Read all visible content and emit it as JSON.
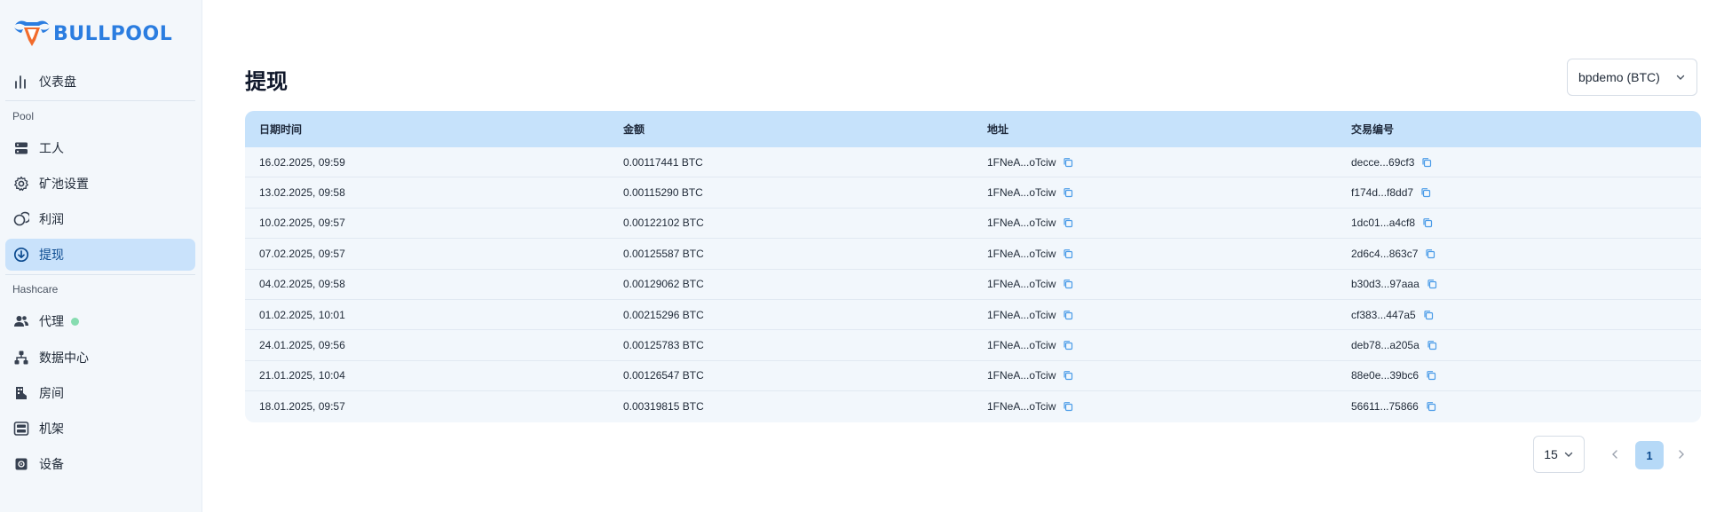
{
  "brand": {
    "name": "BULLPOOL"
  },
  "sidebar": {
    "top_items": [
      {
        "label": "仪表盘",
        "icon": "bar-chart-icon"
      }
    ],
    "sections": [
      {
        "label": "Pool",
        "items": [
          {
            "label": "工人",
            "icon": "server-icon"
          },
          {
            "label": "矿池设置",
            "icon": "gear-icon"
          },
          {
            "label": "利润",
            "icon": "coins-icon"
          },
          {
            "label": "提现",
            "icon": "download-circle-icon",
            "active": true
          }
        ]
      },
      {
        "label": "Hashcare",
        "items": [
          {
            "label": "代理",
            "icon": "users-icon",
            "status_dot": "online"
          },
          {
            "label": "数据中心",
            "icon": "hierarchy-icon"
          },
          {
            "label": "房间",
            "icon": "room-icon"
          },
          {
            "label": "机架",
            "icon": "rack-icon"
          },
          {
            "label": "设备",
            "icon": "device-icon"
          }
        ]
      }
    ]
  },
  "main": {
    "title": "提现",
    "account_select": {
      "value": "bpdemo (BTC)"
    },
    "table": {
      "columns": [
        "日期时间",
        "金额",
        "地址",
        "交易编号"
      ],
      "rows": [
        {
          "datetime": "16.02.2025, 09:59",
          "amount": "0.00117441 BTC",
          "address": "1FNeA...oTciw",
          "txid": "decce...69cf3"
        },
        {
          "datetime": "13.02.2025, 09:58",
          "amount": "0.00115290 BTC",
          "address": "1FNeA...oTciw",
          "txid": "f174d...f8dd7"
        },
        {
          "datetime": "10.02.2025, 09:57",
          "amount": "0.00122102 BTC",
          "address": "1FNeA...oTciw",
          "txid": "1dc01...a4cf8"
        },
        {
          "datetime": "07.02.2025, 09:57",
          "amount": "0.00125587 BTC",
          "address": "1FNeA...oTciw",
          "txid": "2d6c4...863c7"
        },
        {
          "datetime": "04.02.2025, 09:58",
          "amount": "0.00129062 BTC",
          "address": "1FNeA...oTciw",
          "txid": "b30d3...97aaa"
        },
        {
          "datetime": "01.02.2025, 10:01",
          "amount": "0.00215296 BTC",
          "address": "1FNeA...oTciw",
          "txid": "cf383...447a5"
        },
        {
          "datetime": "24.01.2025, 09:56",
          "amount": "0.00125783 BTC",
          "address": "1FNeA...oTciw",
          "txid": "deb78...a205a"
        },
        {
          "datetime": "21.01.2025, 10:04",
          "amount": "0.00126547 BTC",
          "address": "1FNeA...oTciw",
          "txid": "88e0e...39bc6"
        },
        {
          "datetime": "18.01.2025, 09:57",
          "amount": "0.00319815 BTC",
          "address": "1FNeA...oTciw",
          "txid": "56611...75866"
        }
      ]
    },
    "pagination": {
      "page_size": "15",
      "current_page": "1"
    }
  },
  "colors": {
    "accent": "#2b7de0",
    "active_bg": "#c9e2fb",
    "table_header_bg": "#c6e2fb",
    "status_online": "#86dcb0"
  }
}
